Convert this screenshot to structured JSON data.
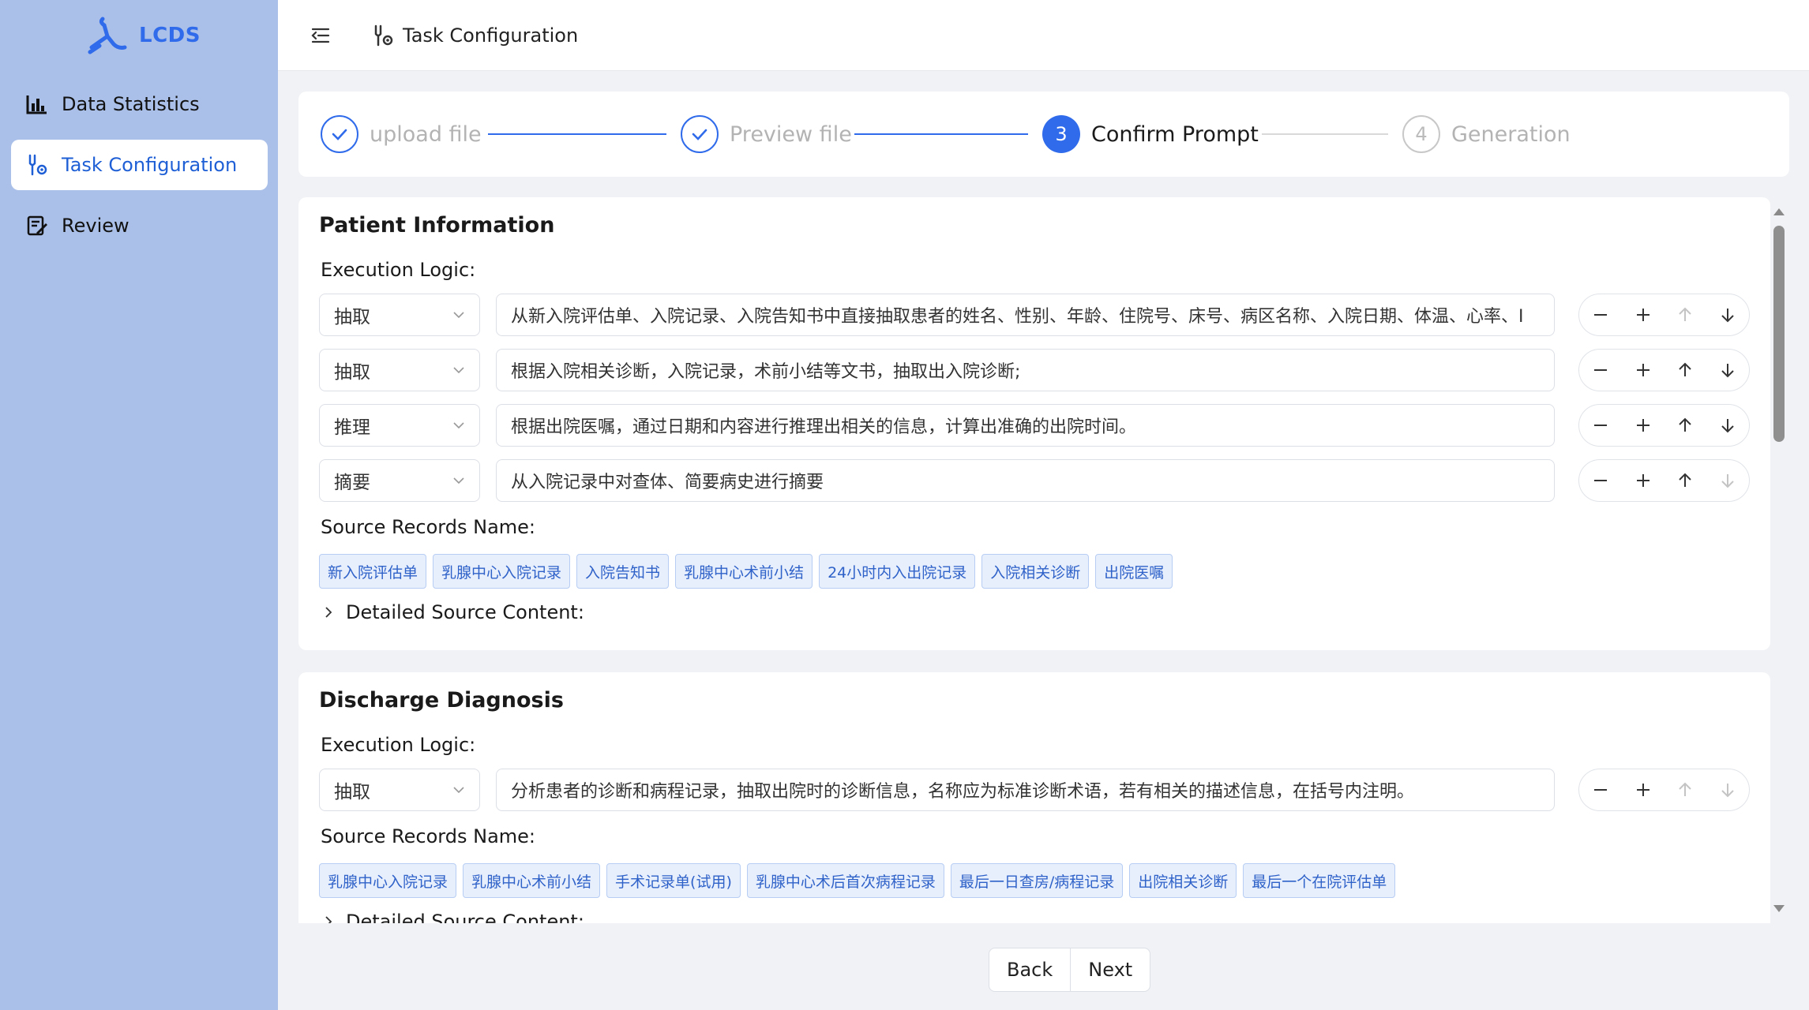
{
  "app": {
    "name": "LCDS"
  },
  "sidebar": {
    "items": [
      {
        "label": "Data Statistics",
        "icon": "bar-chart-icon"
      },
      {
        "label": "Task Configuration",
        "icon": "task-config-icon",
        "active": true
      },
      {
        "label": "Review",
        "icon": "review-icon"
      }
    ]
  },
  "header": {
    "breadcrumb": "Task Configuration"
  },
  "steps": [
    {
      "label": "upload file",
      "state": "done"
    },
    {
      "label": "Preview file",
      "state": "done"
    },
    {
      "number": "3",
      "label": "Confirm Prompt",
      "state": "active"
    },
    {
      "number": "4",
      "label": "Generation",
      "state": "wait"
    }
  ],
  "sections": [
    {
      "title": "Patient Information",
      "execution_label": "Execution Logic:",
      "rows": [
        {
          "type": "抽取",
          "text": "从新入院评估单、入院记录、入院告知书中直接抽取患者的姓名、性别、年龄、住院号、床号、病区名称、入院日期、体温、心率、I"
        },
        {
          "type": "抽取",
          "text": "根据入院相关诊断，入院记录，术前小结等文书，抽取出入院诊断;"
        },
        {
          "type": "推理",
          "text": "根据出院医嘱，通过日期和内容进行推理出相关的信息，计算出准确的出院时间。"
        },
        {
          "type": "摘要",
          "text": "从入院记录中对查体、简要病史进行摘要"
        }
      ],
      "source_label": "Source Records Name:",
      "tags": [
        "新入院评估单",
        "乳腺中心入院记录",
        "入院告知书",
        "乳腺中心术前小结",
        "24小时内入出院记录",
        "入院相关诊断",
        "出院医嘱"
      ],
      "detail_label": "Detailed Source Content:"
    },
    {
      "title": "Discharge Diagnosis",
      "execution_label": "Execution Logic:",
      "rows": [
        {
          "type": "抽取",
          "text": "分析患者的诊断和病程记录，抽取出院时的诊断信息，名称应为标准诊断术语，若有相关的描述信息，在括号内注明。"
        }
      ],
      "source_label": "Source Records Name:",
      "tags": [
        "乳腺中心入院记录",
        "乳腺中心术前小结",
        "手术记录单(试用)",
        "乳腺中心术后首次病程记录",
        "最后一日查房/病程记录",
        "出院相关诊断",
        "最后一个在院评估单"
      ],
      "detail_label": "Detailed Source Content:"
    }
  ],
  "footer": {
    "back_label": "Back",
    "next_label": "Next"
  },
  "colors": {
    "accent": "#2f6bea",
    "sidebar_bg": "#aac0e8",
    "tag_bg": "#e8effc"
  }
}
